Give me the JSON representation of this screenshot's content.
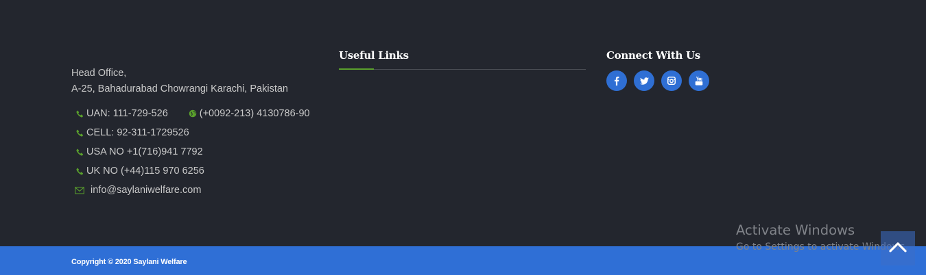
{
  "contact": {
    "address_line1": "Head Office,",
    "address_line2": "A-25, Bahadurabad Chowrangi Karachi, Pakistan",
    "uan": "UAN: 111-729-526",
    "fax": "(+0092-213) 4130786-90",
    "cell": "CELL: 92-311-1729526",
    "usa": "USA NO +1(716)941 7792",
    "uk": "UK NO (+44)115 970 6256",
    "email": "info@saylaniwelfare.com"
  },
  "useful_links": {
    "title": "Useful Links"
  },
  "social": {
    "title": "Connect With Us",
    "icons": [
      "facebook-icon",
      "twitter-icon",
      "instagram-icon",
      "youtube-icon"
    ]
  },
  "footer": {
    "copyright": "Copyright © 2020 Saylani Welfare"
  },
  "watermark": {
    "title": "Activate Windows",
    "subtitle": "Go to Settings to activate Windows."
  },
  "colors": {
    "background": "#23262e",
    "accent_green": "#5aa02c",
    "brand_blue": "#2f6fd6"
  }
}
